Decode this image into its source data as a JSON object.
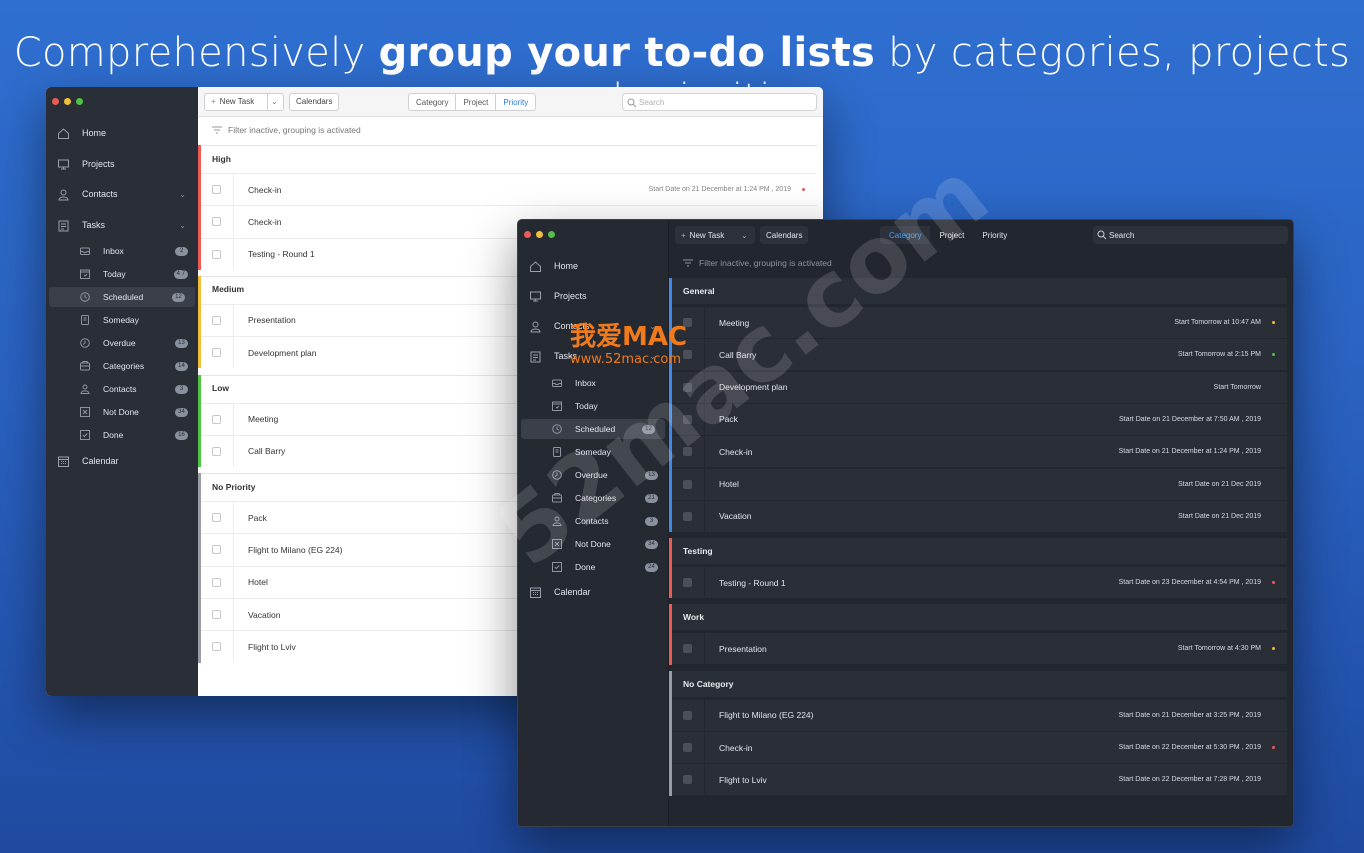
{
  "headline": {
    "pre": "Comprehensively ",
    "bold": "group your to-do lists",
    "post": " by categories, projects and priorities"
  },
  "colors": {
    "red": "#ec5b56",
    "yellow": "#f2be3a",
    "green": "#52c246",
    "gray": "#9a9da3",
    "blue": "#3f8ae8"
  },
  "light": {
    "nav": {
      "home": "Home",
      "projects": "Projects",
      "contacts": "Contacts",
      "tasks": "Tasks",
      "calendar": "Calendar"
    },
    "sub": [
      {
        "label": "Inbox",
        "count": "2",
        "icon": "inbox-icon"
      },
      {
        "label": "Today",
        "count": "4 7",
        "icon": "today-icon"
      },
      {
        "label": "Scheduled",
        "count": "12",
        "icon": "clock-icon"
      },
      {
        "label": "Someday",
        "count": "",
        "icon": "someday-icon"
      },
      {
        "label": "Overdue",
        "count": "13",
        "icon": "overdue-icon"
      },
      {
        "label": "Categories",
        "count": "14",
        "icon": "categories-icon"
      },
      {
        "label": "Contacts",
        "count": "3",
        "icon": "contacts-icon"
      },
      {
        "label": "Not Done",
        "count": "34",
        "icon": "not-done-icon"
      },
      {
        "label": "Done",
        "count": "16",
        "icon": "done-icon"
      }
    ],
    "toolbar": {
      "new_task": "New Task",
      "calendars": "Calendars",
      "seg": [
        "Category",
        "Project",
        "Priority"
      ],
      "search": "Search"
    },
    "filter": "Filter inactive, grouping is activated",
    "groups": [
      {
        "name": "High",
        "rows": [
          {
            "title": "Check-in",
            "date": "Start Date on 21 December at 1:24 PM , 2019"
          },
          {
            "title": "Check-in",
            "date": ""
          },
          {
            "title": "Testing - Round 1",
            "date": ""
          }
        ]
      },
      {
        "name": "Medium",
        "rows": [
          {
            "title": "Presentation",
            "date": ""
          },
          {
            "title": "Development plan",
            "date": ""
          }
        ]
      },
      {
        "name": "Low",
        "rows": [
          {
            "title": "Meeting",
            "date": ""
          },
          {
            "title": "Call Barry",
            "date": ""
          }
        ]
      },
      {
        "name": "No Priority",
        "rows": [
          {
            "title": "Pack",
            "date": ""
          },
          {
            "title": "Flight to Milano (EG 224)",
            "date": ""
          },
          {
            "title": "Hotel",
            "date": ""
          },
          {
            "title": "Vacation",
            "date": ""
          },
          {
            "title": "Flight to Lviv",
            "date": ""
          }
        ]
      }
    ]
  },
  "dark": {
    "nav": {
      "home": "Home",
      "projects": "Projects",
      "contacts": "Contacts",
      "tasks": "Tasks",
      "calendar": "Calendar"
    },
    "sub": [
      {
        "label": "Inbox",
        "count": ""
      },
      {
        "label": "Today",
        "count": ""
      },
      {
        "label": "Scheduled",
        "count": "12"
      },
      {
        "label": "Someday",
        "count": ""
      },
      {
        "label": "Overdue",
        "count": "13"
      },
      {
        "label": "Categories",
        "count": "21"
      },
      {
        "label": "Contacts",
        "count": "3"
      },
      {
        "label": "Not Done",
        "count": "34"
      },
      {
        "label": "Done",
        "count": "24"
      }
    ],
    "toolbar": {
      "new_task": "New Task",
      "calendars": "Calendars",
      "seg": [
        "Category",
        "Project",
        "Priority"
      ],
      "search": "Search"
    },
    "filter": "Filter inactive, grouping is activated",
    "groups": [
      {
        "name": "General",
        "rows": [
          {
            "title": "Meeting",
            "date": "Start Tomorrow at 10:47 AM"
          },
          {
            "title": "Call Barry",
            "date": "Start Tomorrow at 2:15 PM"
          },
          {
            "title": "Development plan",
            "date": "Start Tomorrow"
          },
          {
            "title": "Pack",
            "date": "Start Date on 21 December at 7:50 AM , 2019"
          },
          {
            "title": "Check-in",
            "date": "Start Date on 21 December at 1:24 PM , 2019"
          },
          {
            "title": "Hotel",
            "date": "Start Date on 21 Dec 2019"
          },
          {
            "title": "Vacation",
            "date": "Start Date on 21 Dec 2019"
          }
        ]
      },
      {
        "name": "Testing",
        "rows": [
          {
            "title": "Testing - Round 1",
            "date": "Start Date on 23 December at 4:54 PM , 2019"
          }
        ]
      },
      {
        "name": "Work",
        "rows": [
          {
            "title": "Presentation",
            "date": "Start Tomorrow at 4:30 PM"
          }
        ]
      },
      {
        "name": "No Category",
        "rows": [
          {
            "title": "Flight to Milano (EG 224)",
            "date": "Start Date on 21 December at 3:25 PM , 2019"
          },
          {
            "title": "Check-in",
            "date": "Start Date on 22 December at 5:30 PM , 2019"
          },
          {
            "title": "Flight to Lviv",
            "date": "Start Date on 22 December at 7:28 PM , 2019"
          }
        ]
      }
    ]
  },
  "watermark": {
    "brand": "我爱MAC",
    "url": "www.52mac.com",
    "diag": "52mac.com"
  }
}
